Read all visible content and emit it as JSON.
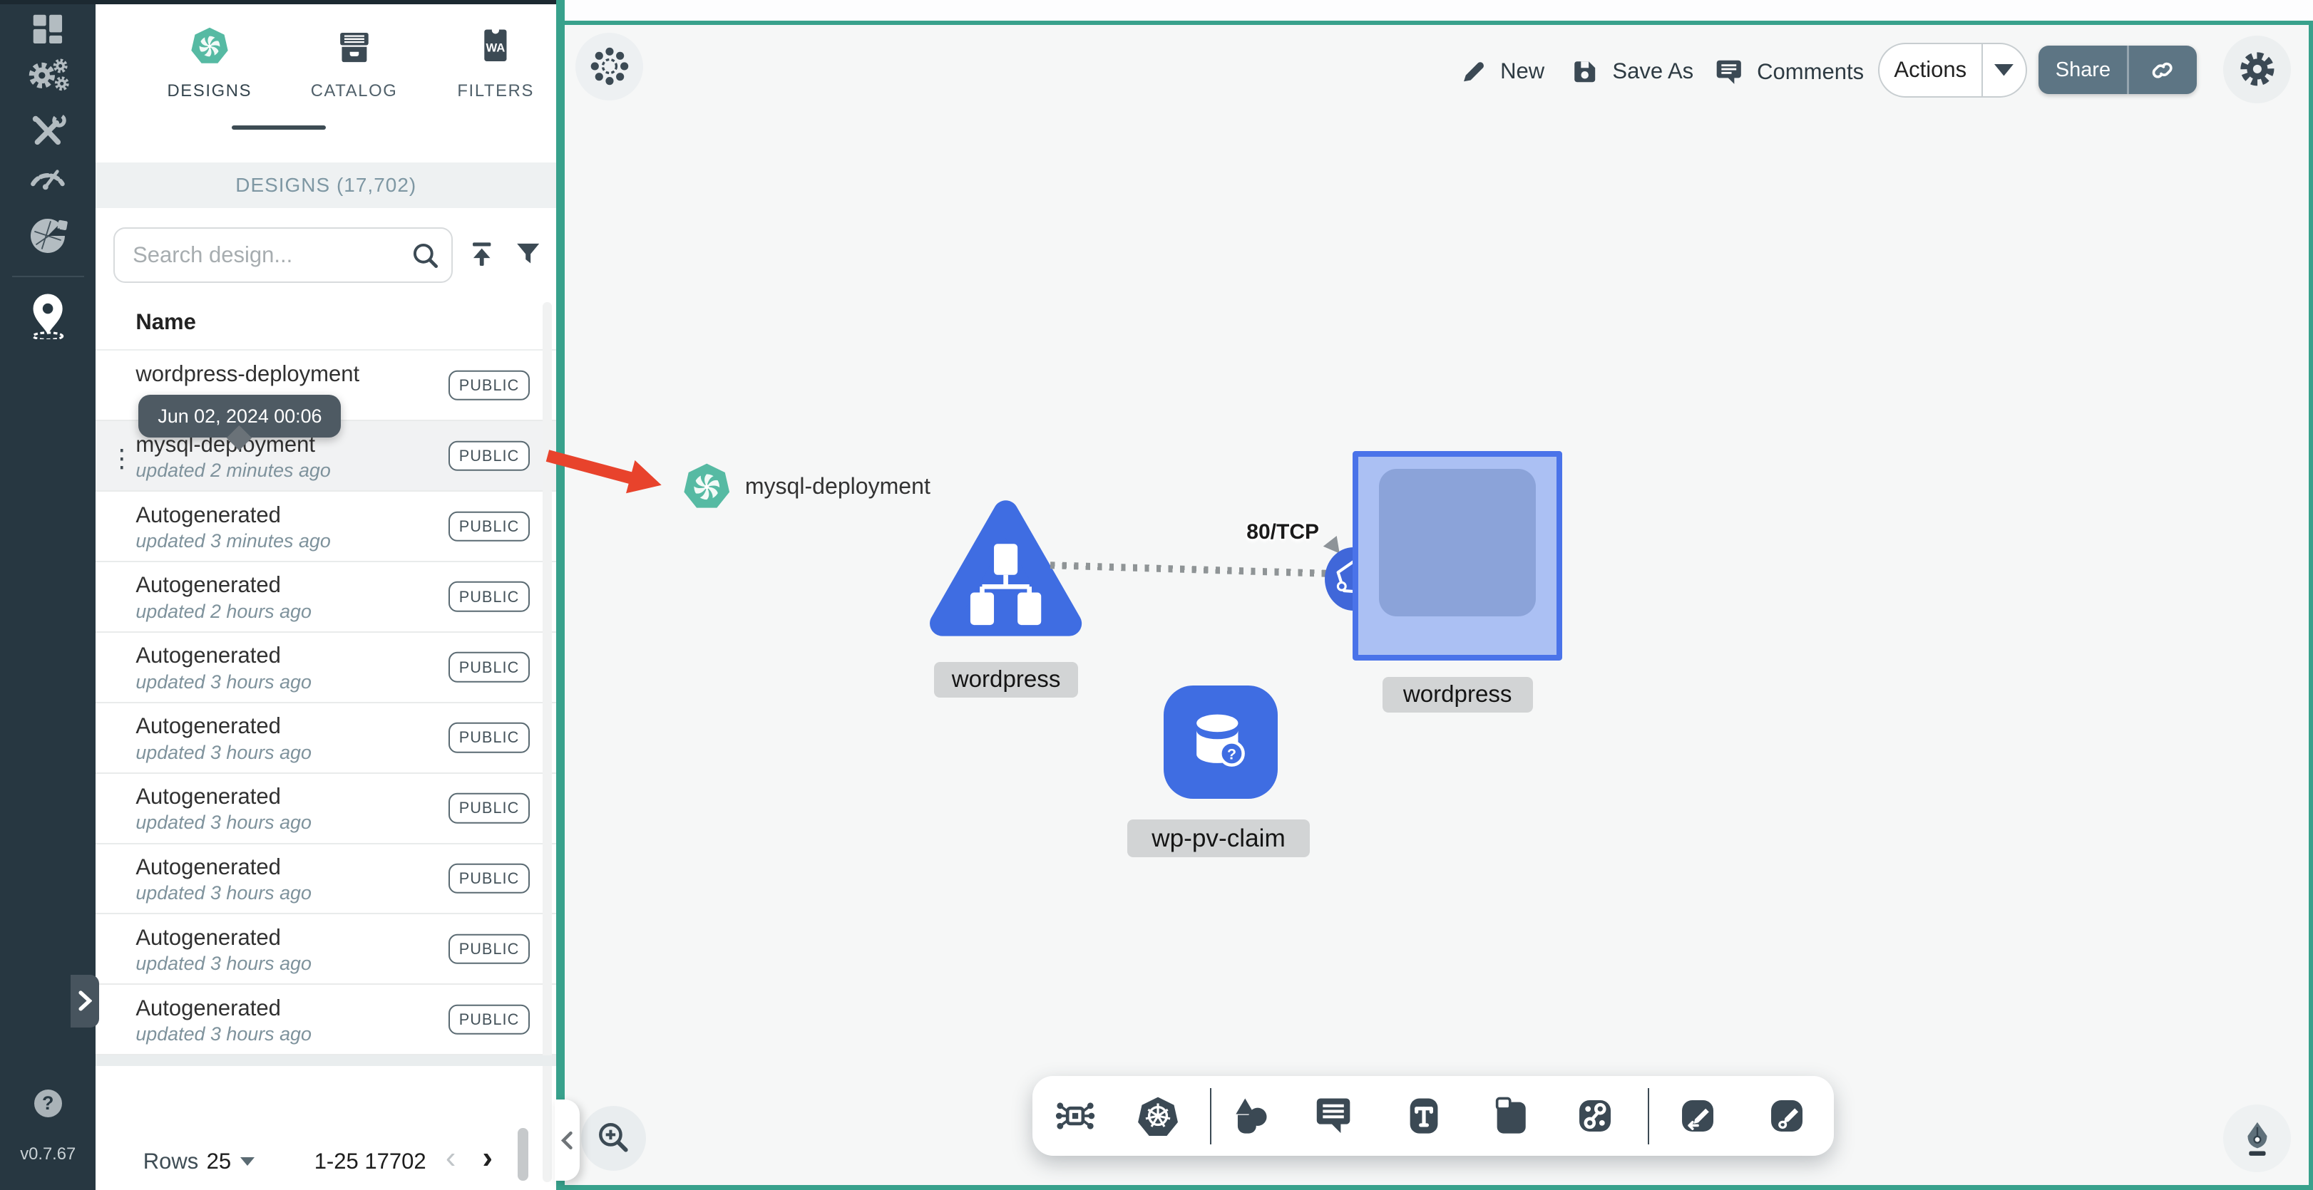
{
  "app": {
    "version": "v0.7.67"
  },
  "sidebar": {
    "items": [
      "dashboard",
      "lifecycle",
      "configuration",
      "performance",
      "extensions",
      "kanvas-pin"
    ],
    "help_label": "?"
  },
  "drawer": {
    "top_tabs": [
      {
        "label": "DESIGNS",
        "active": true
      },
      {
        "label": "CATALOG",
        "active": false
      },
      {
        "label": "FILTERS",
        "active": false
      }
    ],
    "header_title": "DESIGNS (17,702)",
    "search": {
      "placeholder": "Search design..."
    },
    "table": {
      "name_header": "Name"
    },
    "tooltip": "Jun 02, 2024 00:06",
    "rows": [
      {
        "name": "wordpress-deployment",
        "updated": "",
        "badge": "PUBLIC"
      },
      {
        "name": "mysql-deployment",
        "updated": "updated 2 minutes ago",
        "badge": "PUBLIC",
        "highlighted": true
      },
      {
        "name": "Autogenerated",
        "updated": "updated 3 minutes ago",
        "badge": "PUBLIC"
      },
      {
        "name": "Autogenerated",
        "updated": "updated 2 hours ago",
        "badge": "PUBLIC"
      },
      {
        "name": "Autogenerated",
        "updated": "updated 3 hours ago",
        "badge": "PUBLIC"
      },
      {
        "name": "Autogenerated",
        "updated": "updated 3 hours ago",
        "badge": "PUBLIC"
      },
      {
        "name": "Autogenerated",
        "updated": "updated 3 hours ago",
        "badge": "PUBLIC"
      },
      {
        "name": "Autogenerated",
        "updated": "updated 3 hours ago",
        "badge": "PUBLIC"
      },
      {
        "name": "Autogenerated",
        "updated": "updated 3 hours ago",
        "badge": "PUBLIC"
      },
      {
        "name": "Autogenerated",
        "updated": "updated 3 hours ago",
        "badge": "PUBLIC"
      }
    ],
    "pagination": {
      "rows_label": "Rows",
      "per_page": "25",
      "range": "1-25 17702",
      "prev": "‹",
      "next": "›"
    }
  },
  "canvas": {
    "topbar": {
      "new": "New",
      "save_as": "Save As",
      "comments": "Comments",
      "actions": "Actions",
      "share": "Share"
    },
    "bottom_toolbar_icons": [
      "component",
      "kubernetes",
      "shapes",
      "comment",
      "text",
      "note",
      "link",
      "edge-pen",
      "freehand-pen"
    ],
    "nodes": {
      "annotation_label": "mysql-deployment",
      "service_label": "wordpress",
      "edge_label": "80/TCP",
      "deployment_label": "wordpress",
      "pvc_label": "wp-pv-claim"
    }
  },
  "colors": {
    "teal_border": "#38a18c",
    "node_blue": "#3f6de2",
    "selection_blue": "#4a73e9",
    "red_arrow": "#e8432c",
    "sidebar_dark": "#273741",
    "slate_icon": "#3b4954"
  }
}
